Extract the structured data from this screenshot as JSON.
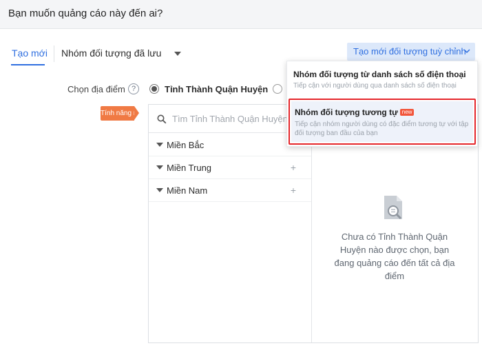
{
  "header": {
    "title": "Bạn muốn quảng cáo này đến ai?"
  },
  "tabs": {
    "create_new": "Tạo mới",
    "saved_groups": "Nhóm đối tượng đã lưu"
  },
  "create_custom_button": {
    "label": "Tạo mới đối tượng tuỳ chỉnh"
  },
  "location": {
    "label": "Chọn địa điểm",
    "help": "?",
    "option_selected": "Tỉnh Thành Quận Huyện"
  },
  "new_feature_badge": "Tính năng mới",
  "search": {
    "placeholder": "Tìm Tỉnh Thành Quận Huyện"
  },
  "regions": [
    {
      "label": "Miền Bắc"
    },
    {
      "label": "Miền Trung"
    },
    {
      "label": "Miền Nam"
    }
  ],
  "empty_state": {
    "text": "Chưa có Tỉnh Thành Quận Huyện nào được chọn, bạn đang quảng cáo đến tất cả địa điểm"
  },
  "dropdown": {
    "items": [
      {
        "title": "Nhóm đối tượng từ danh sách số điện thoại",
        "description": "Tiếp cận với người dùng qua danh sách số điện thoại"
      },
      {
        "title": "Nhóm đối tượng tương tự",
        "tag": "new",
        "description": "Tiếp cận nhóm người dùng có đặc điểm tương tự với tập đối tượng ban đầu của bạn"
      }
    ]
  },
  "colors": {
    "accent": "#2f6fe0",
    "badge_orange": "#f07a44",
    "highlight_red": "#e5252a",
    "new_tag": "#f2553a"
  }
}
